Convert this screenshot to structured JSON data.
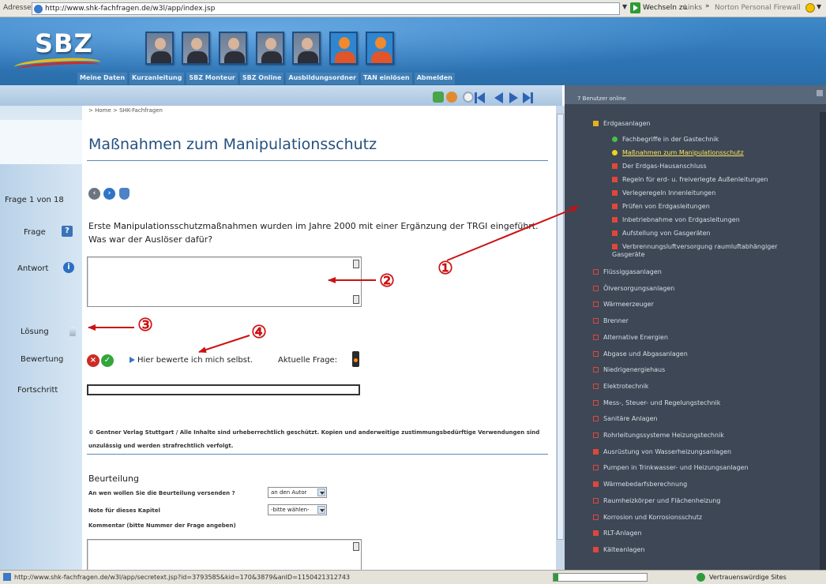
{
  "browser": {
    "address_label": "Adresse",
    "url": "http://www.shk-fachfragen.de/w3l/app/index.jsp",
    "go_label": "Wechseln zu",
    "links_label": "Links",
    "links_more": "»",
    "norton_label": "Norton Personal Firewall"
  },
  "site": {
    "logo": "SBZ",
    "nav": [
      "Meine Daten",
      "Kurzanleitung",
      "SBZ Monteur",
      "SBZ Online",
      "Ausbildungsordner",
      "TAN einlösen",
      "Abmelden"
    ]
  },
  "breadcrumb": "> Home > SHK-Fachfragen",
  "page_title": "Maßnahmen zum Manipulationsschutz",
  "sidebar": {
    "counter": "Frage 1 von 18",
    "frage": "Frage",
    "antwort": "Antwort",
    "loesung": "Lösung",
    "bewertung": "Bewertung",
    "fortschritt": "Fortschritt"
  },
  "question": "Erste Manipulationsschutzmaßnahmen wurden im Jahre 2000 mit einer Ergänzung der TRGI eingeführt. Was war der Auslöser dafür?",
  "answer_value": "",
  "rating": {
    "self_text": "Hier bewerte ich mich selbst.",
    "current_label": "Aktuelle Frage:"
  },
  "progress": {
    "value": 0
  },
  "copyright": "© Gentner Verlag Stuttgart / Alle Inhalte sind urheberrechtlich geschützt. Kopien und anderweitige zustimmungsbedürftige Verwendungen sind unzulässig und werden strafrechtlich verfolgt.",
  "feedback": {
    "title": "Beurteilung",
    "recipient_label": "An wen wollen Sie die Beurteilung versenden ?",
    "recipient_value": "an den Autor",
    "grade_label": "Note für dieses Kapitel",
    "grade_value": "-bitte wählen-",
    "comment_label": "Kommentar (bitte Nummer der Frage angeben)"
  },
  "right_panel": {
    "header": "7 Benutzer online",
    "tree": [
      {
        "label": "Erdgasanlagen",
        "kind": "folder-open",
        "level": 0
      },
      {
        "label": "Fachbegriffe in der Gastechnik",
        "kind": "dot-green",
        "level": 1
      },
      {
        "label": "Maßnahmen zum Manipulationsschutz",
        "kind": "dot-yellow",
        "level": 1,
        "active": true
      },
      {
        "label": "Der Erdgas-Hausanschluss",
        "kind": "square",
        "level": 1
      },
      {
        "label": "Regeln für erd- u. freiverlegte Außenleitungen",
        "kind": "square",
        "level": 1
      },
      {
        "label": "Verlegeregeln Innenleitungen",
        "kind": "square",
        "level": 1
      },
      {
        "label": "Prüfen von Erdgasleitungen",
        "kind": "square",
        "level": 1
      },
      {
        "label": "Inbetriebnahme von Erdgasleitungen",
        "kind": "square",
        "level": 1
      },
      {
        "label": "Aufstellung von Gasgeräten",
        "kind": "square",
        "level": 1
      },
      {
        "label": "Verbrennungsluftversorgung raumluftabhängiger Gasgeräte",
        "kind": "square",
        "level": 1,
        "wrap": true
      },
      {
        "label": "Flüssiggasanlagen",
        "kind": "folder",
        "level": 0
      },
      {
        "label": "Ölversorgungsanlagen",
        "kind": "folder",
        "level": 0
      },
      {
        "label": "Wärmeerzeuger",
        "kind": "folder",
        "level": 0
      },
      {
        "label": "Brenner",
        "kind": "folder",
        "level": 0
      },
      {
        "label": "Alternative Energien",
        "kind": "folder",
        "level": 0
      },
      {
        "label": "Abgase und Abgasanlagen",
        "kind": "folder",
        "level": 0
      },
      {
        "label": "Niedrigenergiehaus",
        "kind": "folder",
        "level": 0
      },
      {
        "label": "Elektrotechnik",
        "kind": "folder",
        "level": 0
      },
      {
        "label": "Mess-, Steuer- und Regelungstechnik",
        "kind": "folder",
        "level": 0
      },
      {
        "label": "Sanitäre Anlagen",
        "kind": "folder",
        "level": 0
      },
      {
        "label": "Rohrleitungssysteme Heizungstechnik",
        "kind": "folder",
        "level": 0
      },
      {
        "label": "Ausrüstung von Wasserheizungsanlagen",
        "kind": "square",
        "level": 0
      },
      {
        "label": "Pumpen in Trinkwasser- und Heizungsanlagen",
        "kind": "folder",
        "level": 0
      },
      {
        "label": "Wärmebedarfsberechnung",
        "kind": "square",
        "level": 0
      },
      {
        "label": "Raumheizkörper und Flächenheizung",
        "kind": "folder",
        "level": 0
      },
      {
        "label": "Korrosion und Korrosionsschutz",
        "kind": "folder",
        "level": 0
      },
      {
        "label": "RLT-Anlagen",
        "kind": "square",
        "level": 0
      },
      {
        "label": "Kälteanlagen",
        "kind": "square",
        "level": 0
      }
    ]
  },
  "annotations": [
    "①",
    "②",
    "③",
    "④"
  ],
  "statusbar": {
    "url": "http://www.shk-fachfragen.de/w3l/app/secretext.jsp?id=3793585&kid=170&3879&anID=1150421312743",
    "progress_fraction": 0.05,
    "trust": "Vertrauenswürdige Sites"
  },
  "colors": {
    "header_blue": "#2e75b6",
    "title_blue": "#25507f",
    "annotation_red": "#cc1010",
    "panel_dark": "#3d4755"
  }
}
